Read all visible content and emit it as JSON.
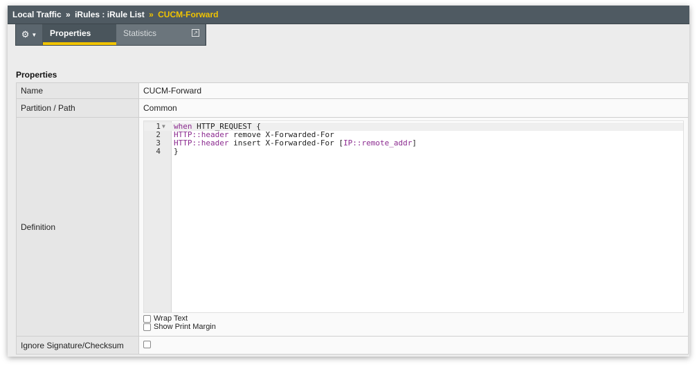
{
  "breadcrumb": {
    "items": [
      "Local Traffic",
      "iRules : iRule List"
    ],
    "separator": "»",
    "current": "CUCM-Forward"
  },
  "tabs": {
    "gear_icon": "gear-icon",
    "properties": "Properties",
    "statistics": "Statistics",
    "external_icon": "↗"
  },
  "section": {
    "title": "Properties"
  },
  "fields": {
    "name_label": "Name",
    "name_value": "CUCM-Forward",
    "partition_label": "Partition / Path",
    "partition_value": "Common",
    "definition_label": "Definition",
    "ignore_label": "Ignore Signature/Checksum"
  },
  "editor": {
    "line_numbers": [
      "1",
      "2",
      "3",
      "4"
    ],
    "lines": [
      {
        "kw": "when",
        "rest": " HTTP_REQUEST {"
      },
      {
        "fn": "HTTP::header",
        "rest": " remove X-Forwarded-For"
      },
      {
        "fn": "HTTP::header",
        "rest": " insert X-Forwarded-For [",
        "fn2": "IP::remote_addr",
        "tail": "]"
      },
      {
        "rest": "}"
      }
    ]
  },
  "options": {
    "wrap_text": "Wrap Text",
    "show_print_margin": "Show Print Margin"
  },
  "colors": {
    "accent": "#f1c400",
    "titlebar": "#4f5a62",
    "keyword": "#8b2a8f",
    "function": "#1f57b3"
  }
}
